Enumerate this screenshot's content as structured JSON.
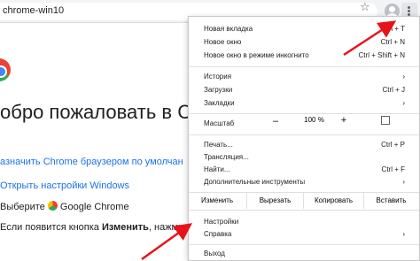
{
  "toolbar": {
    "url_text": "chrome-win10",
    "star_glyph": "☆"
  },
  "page": {
    "welcome": "обро пожаловать в С",
    "link_default_browser": "азначить Chrome браузером по умолчан",
    "link_open_settings": "Открыть настройки Windows",
    "step_choose_prefix": "Выберите",
    "step_choose_app": "Google Chrome",
    "step_change_prefix": "Если появится кнопка ",
    "step_change_bold": "Изменить",
    "step_change_suffix": ", нажмите"
  },
  "menu": {
    "new_tab": {
      "label": "Новая вкладка",
      "shortcut": "Ctrl + T"
    },
    "new_window": {
      "label": "Новое окно",
      "shortcut": "Ctrl + N"
    },
    "incognito": {
      "label": "Новое окно в режиме инкогнито",
      "shortcut": "Ctrl + Shift + N"
    },
    "history": {
      "label": "История"
    },
    "downloads": {
      "label": "Загрузки",
      "shortcut": "Ctrl + J"
    },
    "bookmarks": {
      "label": "Закладки"
    },
    "zoom": {
      "label": "Масштаб",
      "minus": "–",
      "value": "100 %",
      "plus": "+"
    },
    "print": {
      "label": "Печать...",
      "shortcut": "Ctrl + P"
    },
    "cast": {
      "label": "Трансляция..."
    },
    "find": {
      "label": "Найти...",
      "shortcut": "Ctrl + F"
    },
    "more_tools": {
      "label": "Дополнительные инструменты"
    },
    "edit": {
      "label": "Изменить",
      "cut": "Вырезать",
      "copy": "Копировать",
      "paste": "Вставить"
    },
    "settings": {
      "label": "Настройки"
    },
    "help": {
      "label": "Справка"
    },
    "exit": {
      "label": "Выход"
    }
  },
  "colors": {
    "link": "#1a73e8",
    "arrow": "#e8121b",
    "menu_border": "#c8c8c8"
  }
}
